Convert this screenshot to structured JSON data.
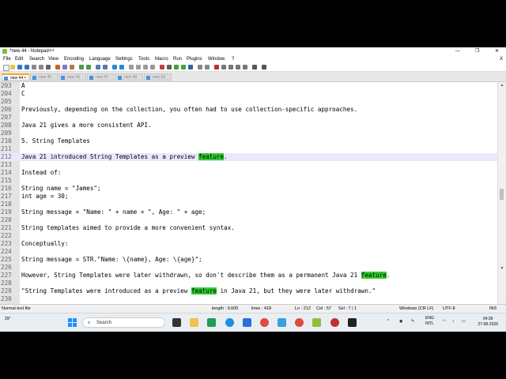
{
  "window": {
    "title": "*new 44 - Notepad++",
    "minimize": "—",
    "restore": "❐",
    "close": "✕"
  },
  "menu": [
    "File",
    "Edit",
    "Search",
    "View",
    "Encoding",
    "Language",
    "Settings",
    "Tools",
    "Macro",
    "Run",
    "Plugins",
    "Window",
    "?"
  ],
  "menu_close": "X",
  "tabs": [
    {
      "label": "new 44",
      "active": true
    },
    {
      "label": "new 45",
      "active": false
    },
    {
      "label": "new 46",
      "active": false
    },
    {
      "label": "new 47",
      "active": false
    },
    {
      "label": "new 48",
      "active": false
    },
    {
      "label": "new 50",
      "active": false
    }
  ],
  "editor": {
    "lines": [
      {
        "n": "203",
        "t": "A"
      },
      {
        "n": "204",
        "t": "C"
      },
      {
        "n": "205",
        "t": ""
      },
      {
        "n": "206",
        "t": "Previously, depending on the collection, you often had to use collection-specific approaches."
      },
      {
        "n": "207",
        "t": ""
      },
      {
        "n": "208",
        "t": "Java 21 gives a more consistent API."
      },
      {
        "n": "209",
        "t": ""
      },
      {
        "n": "210",
        "t": "5. String Templates"
      },
      {
        "n": "211",
        "t": ""
      },
      {
        "n": "212",
        "pre": "Java 21 introduced String Templates as a preview ",
        "hl": "feature",
        "post": ".",
        "current": true
      },
      {
        "n": "213",
        "t": ""
      },
      {
        "n": "214",
        "t": "Instead of:"
      },
      {
        "n": "215",
        "t": ""
      },
      {
        "n": "216",
        "t": "String name = \"James\";"
      },
      {
        "n": "217",
        "t": "int age = 30;"
      },
      {
        "n": "218",
        "t": ""
      },
      {
        "n": "219",
        "t": "String message = \"Name: \" + name + \", Age: \" + age;"
      },
      {
        "n": "220",
        "t": ""
      },
      {
        "n": "221",
        "t": "String templates aimed to provide a more convenient syntax."
      },
      {
        "n": "222",
        "t": ""
      },
      {
        "n": "223",
        "t": "Conceptually:"
      },
      {
        "n": "224",
        "t": ""
      },
      {
        "n": "225",
        "t": "String message = STR.\"Name: \\{name}, Age: \\{age}\";"
      },
      {
        "n": "226",
        "t": ""
      },
      {
        "n": "227",
        "pre": "However, String Templates were later withdrawn, so don't describe them as a permanent Java 21 ",
        "hl": "feature",
        "post": "."
      },
      {
        "n": "228",
        "t": ""
      },
      {
        "n": "229",
        "pre": "\"String Templates were introduced as a preview ",
        "hl": "feature",
        "post": " in Java 21, but they were later withdrawn.\""
      },
      {
        "n": "230",
        "t": ""
      }
    ]
  },
  "status": {
    "filetype": "Normal text file",
    "length": "length : 9,605",
    "lines": "lines : 418",
    "position": "Ln : 212",
    "col": "Col : 57",
    "sel": "Sel : 7 | 1",
    "eol": "Windows (CR LF)",
    "encoding": "UTF-8",
    "mode": "INS"
  },
  "taskbar": {
    "weather": "29°",
    "search_placeholder": "Search",
    "lang1": "ENG",
    "lang2": "INTL",
    "time": "04:39",
    "date": "27-08-2026"
  },
  "colors": {
    "highlight": "#33cc33",
    "current_line": "#e8e8ff",
    "tab_accent": "#f5a623"
  }
}
